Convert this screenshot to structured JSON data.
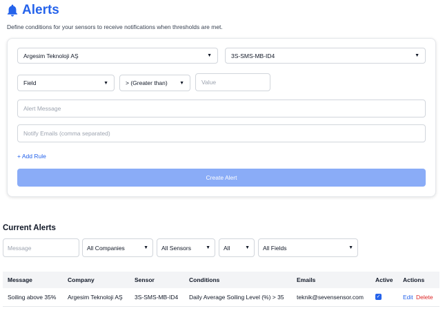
{
  "header": {
    "title": "Alerts",
    "subtitle": "Define conditions for your sensors to receive notifications when thresholds are met.",
    "icon": "bell-icon",
    "accent_color": "#2563eb"
  },
  "form": {
    "company_select": "Argesim Teknoloji AŞ",
    "sensor_select": "3S-SMS-MB-ID4",
    "field_select": "Field",
    "operator_select": "> (Greater than)",
    "value_placeholder": "Value",
    "message_placeholder": "Alert Message",
    "emails_placeholder": "Notify Emails (comma separated)",
    "add_rule_label": "+ Add Rule",
    "create_button_label": "Create Alert"
  },
  "current_alerts": {
    "title": "Current Alerts",
    "filters": {
      "message_placeholder": "Message",
      "company": "All Companies",
      "sensor": "All Sensors",
      "status": "All",
      "field": "All Fields"
    },
    "columns": [
      "Message",
      "Company",
      "Sensor",
      "Conditions",
      "Emails",
      "Active",
      "Actions"
    ],
    "rows": [
      {
        "message": "Soiling above 35%",
        "company": "Argesim Teknoloji AŞ",
        "sensor": "3S-SMS-MB-ID4",
        "conditions": "Daily Average Soiling Level (%) > 35",
        "emails": "teknik@sevensensor.com",
        "active": true,
        "edit_label": "Edit",
        "delete_label": "Delete"
      }
    ]
  }
}
